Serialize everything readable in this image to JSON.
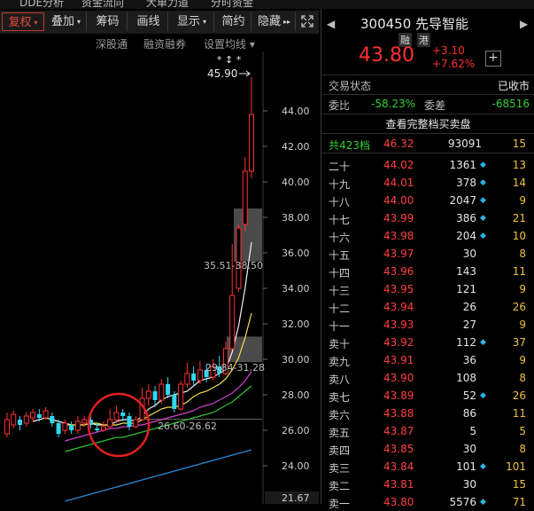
{
  "top_tabs": [
    "DDE分析",
    "资金流向",
    "大单力道",
    "分时资金"
  ],
  "toolbar": {
    "items": [
      {
        "label": "复权",
        "arrow": "▾",
        "active": true
      },
      {
        "label": "叠加",
        "arrow": "▾",
        "active": false
      },
      {
        "label": "筹码",
        "arrow": "",
        "active": false
      },
      {
        "label": "画线",
        "arrow": "",
        "active": false
      },
      {
        "label": "显示",
        "arrow": "▾",
        "active": false
      },
      {
        "label": "简约",
        "arrow": "",
        "active": false
      },
      {
        "label": "隐藏",
        "arrow": "▸▸",
        "active": false
      }
    ],
    "expand_icon": "expand-icon"
  },
  "subbar": {
    "items": [
      "深股通",
      "融资融券",
      "设置均线 ▾"
    ]
  },
  "chart": {
    "y_ticks": [
      "44.00",
      "42.00",
      "40.00",
      "38.00",
      "36.00",
      "34.00",
      "32.00",
      "30.00",
      "28.00",
      "26.00",
      "24.00"
    ],
    "bottom_label": "21.67",
    "high_label": "45.90",
    "zone_label_top": "35.51-38.50",
    "zone_label_mid": "29.84-31.28",
    "zone_label_low": "26.60-26.62",
    "markers": "*  ↕  *"
  },
  "chart_data": {
    "type": "candlestick",
    "ylim": [
      21.67,
      46.5
    ],
    "y_ticks": [
      24,
      26,
      28,
      30,
      32,
      34,
      36,
      38,
      40,
      42,
      44
    ],
    "candles": [
      {
        "o": 25.8,
        "c": 26.6,
        "h": 27.0,
        "l": 25.6
      },
      {
        "o": 26.3,
        "c": 26.9,
        "h": 27.1,
        "l": 26.1
      },
      {
        "o": 26.6,
        "c": 26.3,
        "h": 26.8,
        "l": 26.0
      },
      {
        "o": 26.4,
        "c": 26.8,
        "h": 27.0,
        "l": 26.2
      },
      {
        "o": 26.7,
        "c": 27.0,
        "h": 27.2,
        "l": 26.5
      },
      {
        "o": 26.9,
        "c": 26.7,
        "h": 27.2,
        "l": 26.5
      },
      {
        "o": 26.7,
        "c": 27.1,
        "h": 27.3,
        "l": 26.6
      },
      {
        "o": 26.8,
        "c": 26.4,
        "h": 27.0,
        "l": 26.2
      },
      {
        "o": 26.4,
        "c": 25.8,
        "h": 26.6,
        "l": 25.6
      },
      {
        "o": 26.0,
        "c": 26.4,
        "h": 26.6,
        "l": 25.8
      },
      {
        "o": 26.3,
        "c": 26.0,
        "h": 26.5,
        "l": 25.8
      },
      {
        "o": 26.0,
        "c": 26.5,
        "h": 26.8,
        "l": 25.8
      },
      {
        "o": 26.4,
        "c": 26.6,
        "h": 26.8,
        "l": 26.2
      },
      {
        "o": 26.6,
        "c": 26.3,
        "h": 26.9,
        "l": 26.1
      },
      {
        "o": 26.1,
        "c": 26.0,
        "h": 26.4,
        "l": 25.9
      },
      {
        "o": 26.0,
        "c": 26.2,
        "h": 26.5,
        "l": 25.9
      },
      {
        "o": 26.2,
        "c": 26.6,
        "h": 27.2,
        "l": 26.1
      },
      {
        "o": 26.6,
        "c": 27.0,
        "h": 27.4,
        "l": 26.4
      },
      {
        "o": 27.0,
        "c": 26.8,
        "h": 27.2,
        "l": 26.5
      },
      {
        "o": 26.8,
        "c": 26.2,
        "h": 27.0,
        "l": 26.0
      },
      {
        "o": 26.2,
        "c": 26.6,
        "h": 26.8,
        "l": 26.1
      },
      {
        "o": 26.6,
        "c": 27.8,
        "h": 28.4,
        "l": 26.5
      },
      {
        "o": 27.8,
        "c": 28.2,
        "h": 28.6,
        "l": 27.4
      },
      {
        "o": 28.2,
        "c": 27.7,
        "h": 28.5,
        "l": 27.3
      },
      {
        "o": 27.7,
        "c": 28.6,
        "h": 28.9,
        "l": 27.5
      },
      {
        "o": 28.6,
        "c": 28.0,
        "h": 29.0,
        "l": 27.8
      },
      {
        "o": 28.0,
        "c": 27.2,
        "h": 28.2,
        "l": 27.0
      },
      {
        "o": 27.2,
        "c": 28.6,
        "h": 28.8,
        "l": 27.1
      },
      {
        "o": 28.6,
        "c": 29.2,
        "h": 29.8,
        "l": 28.4
      },
      {
        "o": 29.2,
        "c": 28.8,
        "h": 29.6,
        "l": 28.5
      },
      {
        "o": 28.8,
        "c": 29.4,
        "h": 29.9,
        "l": 28.6
      },
      {
        "o": 29.4,
        "c": 29.0,
        "h": 29.7,
        "l": 28.7
      },
      {
        "o": 29.0,
        "c": 29.6,
        "h": 30.0,
        "l": 28.8
      },
      {
        "o": 29.6,
        "c": 29.2,
        "h": 30.2,
        "l": 29.0
      },
      {
        "o": 29.2,
        "c": 30.6,
        "h": 31.0,
        "l": 29.1
      },
      {
        "o": 30.6,
        "c": 33.6,
        "h": 36.5,
        "l": 30.6
      },
      {
        "o": 34.0,
        "c": 37.4,
        "h": 37.6,
        "l": 33.8
      },
      {
        "o": 37.6,
        "c": 40.6,
        "h": 41.4,
        "l": 37.2
      },
      {
        "o": 40.6,
        "c": 43.8,
        "h": 45.9,
        "l": 40.2
      }
    ],
    "ma_series": [
      {
        "name": "",
        "color": "#f0f0f0",
        "values": [
          null,
          null,
          null,
          null,
          26.5,
          26.6,
          26.7,
          26.6,
          26.5,
          26.4,
          26.3,
          26.3,
          26.3,
          26.4,
          26.3,
          26.3,
          26.3,
          26.5,
          26.6,
          26.6,
          26.5,
          26.8,
          27.2,
          27.4,
          27.7,
          27.9,
          28.0,
          28.1,
          28.2,
          28.5,
          28.8,
          28.9,
          29.0,
          29.2,
          29.4,
          30.4,
          31.9,
          34.0,
          36.6
        ]
      },
      {
        "name": "",
        "color": "#f2e04a",
        "values": [
          null,
          null,
          null,
          null,
          null,
          null,
          null,
          null,
          null,
          26.3,
          26.3,
          26.3,
          26.3,
          26.4,
          26.4,
          26.3,
          26.3,
          26.3,
          26.4,
          26.4,
          26.4,
          26.6,
          26.8,
          27.0,
          27.2,
          27.3,
          27.3,
          27.4,
          27.6,
          27.9,
          28.1,
          28.2,
          28.4,
          28.6,
          28.9,
          29.4,
          30.1,
          31.2,
          32.6
        ]
      },
      {
        "name": "",
        "color": "#d040d0",
        "values": [
          null,
          null,
          null,
          null,
          null,
          null,
          null,
          null,
          null,
          25.4,
          25.5,
          25.6,
          25.7,
          25.8,
          25.9,
          26.0,
          26.1,
          26.1,
          26.2,
          26.2,
          26.3,
          26.3,
          26.4,
          26.5,
          26.6,
          26.7,
          26.8,
          26.9,
          27.0,
          27.1,
          27.3,
          27.4,
          27.5,
          27.7,
          27.9,
          28.1,
          28.4,
          28.8,
          29.3
        ]
      },
      {
        "name": "",
        "color": "#30c030",
        "values": [
          null,
          null,
          null,
          null,
          null,
          null,
          null,
          null,
          null,
          24.8,
          24.9,
          25.0,
          25.1,
          25.2,
          25.3,
          25.4,
          25.5,
          25.6,
          25.6,
          25.7,
          25.8,
          25.9,
          26.0,
          26.1,
          26.2,
          26.3,
          26.4,
          26.5,
          26.6,
          26.7,
          26.8,
          26.9,
          27.0,
          27.2,
          27.4,
          27.6,
          27.9,
          28.2,
          28.5
        ]
      },
      {
        "name": "",
        "color": "#2a8ad8",
        "values": [
          null,
          null,
          null,
          null,
          null,
          null,
          null,
          null,
          null,
          22.0,
          22.1,
          22.2,
          22.3,
          22.4,
          22.5,
          22.6,
          22.7,
          22.8,
          22.9,
          23.0,
          23.1,
          23.2,
          23.3,
          23.4,
          23.5,
          23.6,
          23.7,
          23.8,
          23.9,
          24.0,
          24.1,
          24.2,
          24.3,
          24.4,
          24.5,
          24.6,
          24.7,
          24.8,
          24.9
        ]
      }
    ],
    "zones": [
      {
        "low": 35.51,
        "high": 38.5,
        "label": "35.51-38.50"
      },
      {
        "low": 29.84,
        "high": 31.28,
        "label": "29.84-31.28"
      },
      {
        "low": 26.6,
        "high": 26.62,
        "label": "26.60-26.62"
      }
    ],
    "high": 45.9
  },
  "stock": {
    "code_name": "300450 先导智能",
    "badges": [
      "融",
      "港"
    ],
    "price": "43.80",
    "change": "+3.10",
    "change_pct": "+7.62%"
  },
  "status": {
    "label": "交易状态",
    "value": "已收市"
  },
  "weibi": {
    "label": "委比",
    "value": "-58.23%",
    "diff_label": "委差",
    "diff_value": "-68516"
  },
  "full_book_link": "查看完整档买卖盘",
  "total_row": {
    "label": "共423档",
    "price": "46.32",
    "vol": "93091",
    "count": "15"
  },
  "asks": [
    {
      "label": "二十",
      "price": "44.02",
      "vol": "1361",
      "dia": true,
      "count": "13"
    },
    {
      "label": "十九",
      "price": "44.01",
      "vol": "378",
      "dia": true,
      "count": "14"
    },
    {
      "label": "十八",
      "price": "44.00",
      "vol": "2047",
      "dia": true,
      "count": "9"
    },
    {
      "label": "十七",
      "price": "43.99",
      "vol": "386",
      "dia": true,
      "count": "21"
    },
    {
      "label": "十六",
      "price": "43.98",
      "vol": "204",
      "dia": true,
      "count": "10"
    },
    {
      "label": "十五",
      "price": "43.97",
      "vol": "30",
      "dia": false,
      "count": "8"
    },
    {
      "label": "十四",
      "price": "43.96",
      "vol": "143",
      "dia": false,
      "count": "11"
    },
    {
      "label": "十三",
      "price": "43.95",
      "vol": "121",
      "dia": false,
      "count": "9"
    },
    {
      "label": "十二",
      "price": "43.94",
      "vol": "26",
      "dia": false,
      "count": "26"
    },
    {
      "label": "十一",
      "price": "43.93",
      "vol": "27",
      "dia": false,
      "count": "9"
    },
    {
      "label": "卖十",
      "price": "43.92",
      "vol": "112",
      "dia": true,
      "count": "37"
    },
    {
      "label": "卖九",
      "price": "43.91",
      "vol": "36",
      "dia": false,
      "count": "9"
    },
    {
      "label": "卖八",
      "price": "43.90",
      "vol": "108",
      "dia": false,
      "count": "8"
    },
    {
      "label": "卖七",
      "price": "43.89",
      "vol": "52",
      "dia": true,
      "count": "26"
    },
    {
      "label": "卖六",
      "price": "43.88",
      "vol": "86",
      "dia": false,
      "count": "11"
    },
    {
      "label": "卖五",
      "price": "43.87",
      "vol": "5",
      "dia": false,
      "count": "5"
    },
    {
      "label": "卖四",
      "price": "43.85",
      "vol": "30",
      "dia": false,
      "count": "8"
    },
    {
      "label": "卖三",
      "price": "43.84",
      "vol": "101",
      "dia": true,
      "count": "101"
    },
    {
      "label": "卖二",
      "price": "43.81",
      "vol": "30",
      "dia": false,
      "count": "15"
    },
    {
      "label": "卖一",
      "price": "43.80",
      "vol": "5576",
      "dia": true,
      "count": "71"
    }
  ],
  "colors": {
    "up": "#ff3030",
    "down": "#30d8f0",
    "text": "#d0d0d0",
    "count": "#f0c040",
    "green": "#30d030"
  }
}
